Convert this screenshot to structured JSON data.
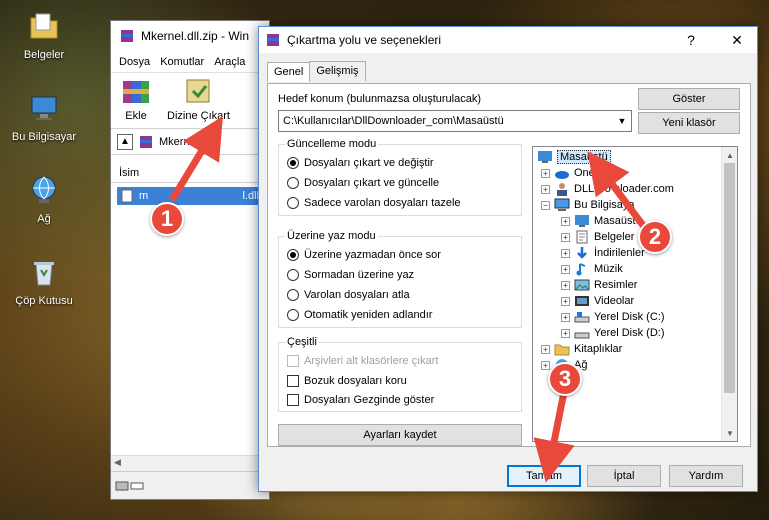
{
  "desktop": {
    "icons": [
      {
        "label": "Belgeler"
      },
      {
        "label": "Bu Bilgisayar"
      },
      {
        "label": "Ağ"
      },
      {
        "label": "Çöp Kutusu"
      }
    ]
  },
  "bgwindow": {
    "title": "Mkernel.dll.zip - Win",
    "menu": [
      "Dosya",
      "Komutlar",
      "Araçla"
    ],
    "toolbar": {
      "add": "Ekle",
      "extract": "Dizine Çıkart"
    },
    "address": "Mkernel.dll.",
    "column_name": "İsim",
    "file": "mkernel.dll",
    "file_prefix": "m",
    "file_suffix": "l.dll"
  },
  "dialog": {
    "title": "Çıkartma yolu ve seçenekleri",
    "help_icon": "?",
    "close_icon": "✕",
    "tabs": [
      "Genel",
      "Gelişmiş"
    ],
    "target_label": "Hedef konum (bulunmazsa oluşturulacak)",
    "target_value": "C:\\Kullanıcılar\\DllDownloader_com\\Masaüstü",
    "show_button": "Göster",
    "new_folder_button": "Yeni klasör",
    "update_mode": {
      "label": "Güncelleme modu",
      "options": [
        "Dosyaları çıkart ve değiştir",
        "Dosyaları çıkart ve güncelle",
        "Sadece varolan dosyaları tazele"
      ],
      "selected": 0
    },
    "overwrite_mode": {
      "label": "Üzerine yaz modu",
      "options": [
        "Üzerine yazmadan önce sor",
        "Sormadan üzerine yaz",
        "Varolan dosyaları atla",
        "Otomatik yeniden adlandır"
      ],
      "selected": 0
    },
    "misc": {
      "label": "Çeşitli",
      "options": [
        "Arşivleri alt klasörlere çıkart",
        "Bozuk dosyaları koru",
        "Dosyaları Gezginde göster"
      ]
    },
    "save_settings": "Ayarları kaydet",
    "tree": {
      "root": "Masaüstü",
      "items": [
        "OneD",
        "DLL Do    nloader.com",
        "Bu Bilgisaya",
        "Masaüstü",
        "Belgeler",
        "İndirilenler",
        "Müzik",
        "Resimler",
        "Videolar",
        "Yerel Disk (C:)",
        "Yerel Disk (D:)",
        "Kitaplıklar",
        "Ağ"
      ]
    },
    "ok_button": "Tamam",
    "cancel_button": "İptal",
    "help_button": "Yardım"
  },
  "annotations": [
    "1",
    "2",
    "3"
  ],
  "colors": {
    "accent": "#e8493b",
    "selection": "#3b82d6"
  }
}
